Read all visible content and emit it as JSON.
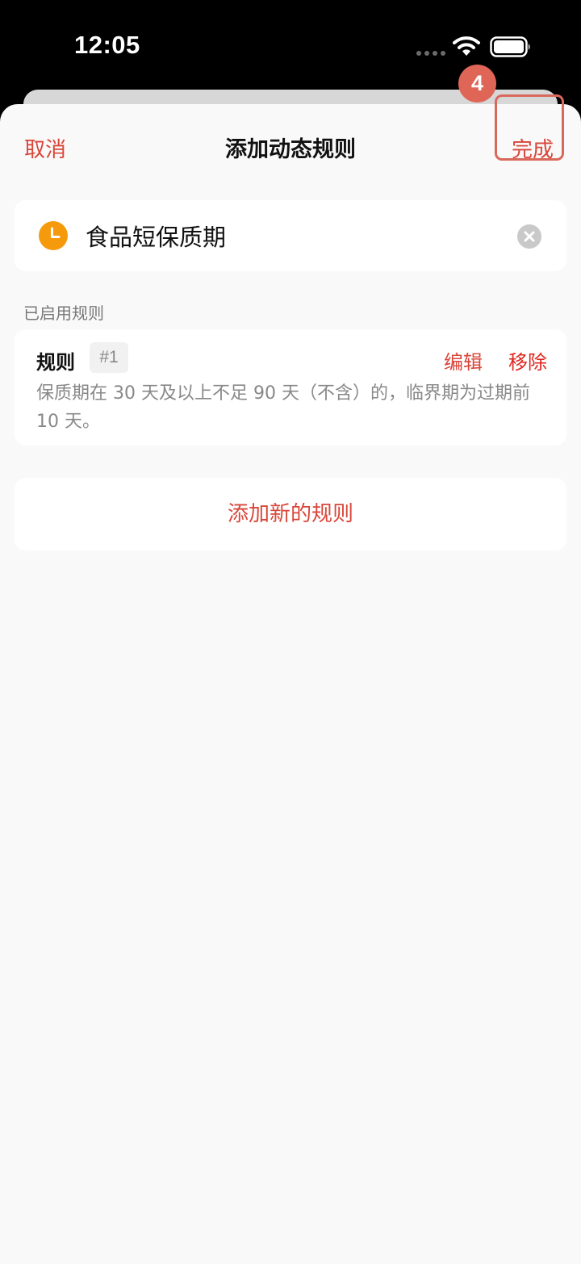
{
  "status_bar": {
    "time": "12:05",
    "icons": [
      "cellular-dots-icon",
      "wifi-icon",
      "battery-icon"
    ]
  },
  "nav": {
    "cancel_label": "取消",
    "title": "添加动态规则",
    "done_label": "完成"
  },
  "step_badge": "4",
  "name_field": {
    "icon": "clock-icon",
    "value": "食品短保质期",
    "clear_icon": "clear-icon"
  },
  "section_label": "已启用规则",
  "rules": [
    {
      "title": "规则",
      "index": "#1",
      "edit_label": "编辑",
      "remove_label": "移除",
      "description": "保质期在 30 天及以上不足 90 天（不含）的，临界期为过期前 10 天。"
    }
  ],
  "add_rule_label": "添加新的规则",
  "colors": {
    "accent": "#d9463a",
    "remove": "#e0251d",
    "clock": "#f59a0c",
    "highlight": "#d9685c",
    "background": "#f9f9f9"
  }
}
